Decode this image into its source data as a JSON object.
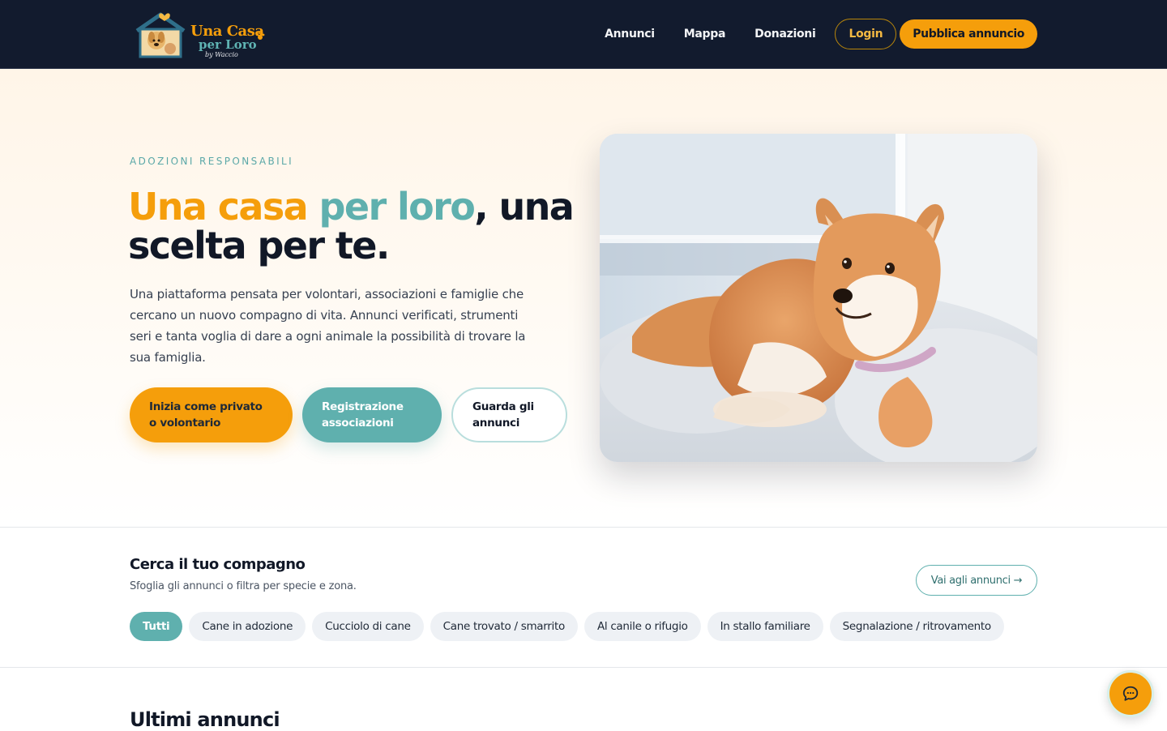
{
  "brand": {
    "line1": "Una Casa",
    "line2": "per Loro",
    "line3": "by Waccio",
    "colors": {
      "orange": "#f59e0b",
      "teal": "#5fb0ae",
      "navy": "#121b2e"
    }
  },
  "nav": {
    "links": [
      "Annunci",
      "Mappa",
      "Donazioni"
    ],
    "login_label": "Login",
    "publish_label": "Pubblica annuncio"
  },
  "hero": {
    "eyebrow": "ADOZIONI RESPONSABILI",
    "title_part1": "Una casa",
    "title_part2": "per loro",
    "title_part3": ", una scelta per te.",
    "description": "Una piattaforma pensata per volontari, associazioni e famiglie che cercano un nuovo compagno di vita. Annunci verificati, strumenti seri e tanta voglia di dare a ogni animale la possibilità di trovare la sua famiglia.",
    "cta_private": "Inizia come privato o volontario",
    "cta_assoc": "Registrazione associazioni",
    "cta_browse": "Guarda gli annunci"
  },
  "search": {
    "title": "Cerca il tuo compagno",
    "subtitle": "Sfoglia gli annunci o filtra per specie e zona.",
    "all_ads_label": "Vai agli annunci →",
    "chips": [
      "Tutti",
      "Cane in adozione",
      "Cucciolo di cane",
      "Cane trovato / smarrito",
      "Al canile o rifugio",
      "In stallo familiare",
      "Segnalazione / ritrovamento"
    ],
    "active_chip": "Tutti"
  },
  "latest": {
    "title": "Ultimi annunci"
  },
  "icons": {
    "chat": "chat-bubble-icon",
    "paw": "paw-icon"
  }
}
